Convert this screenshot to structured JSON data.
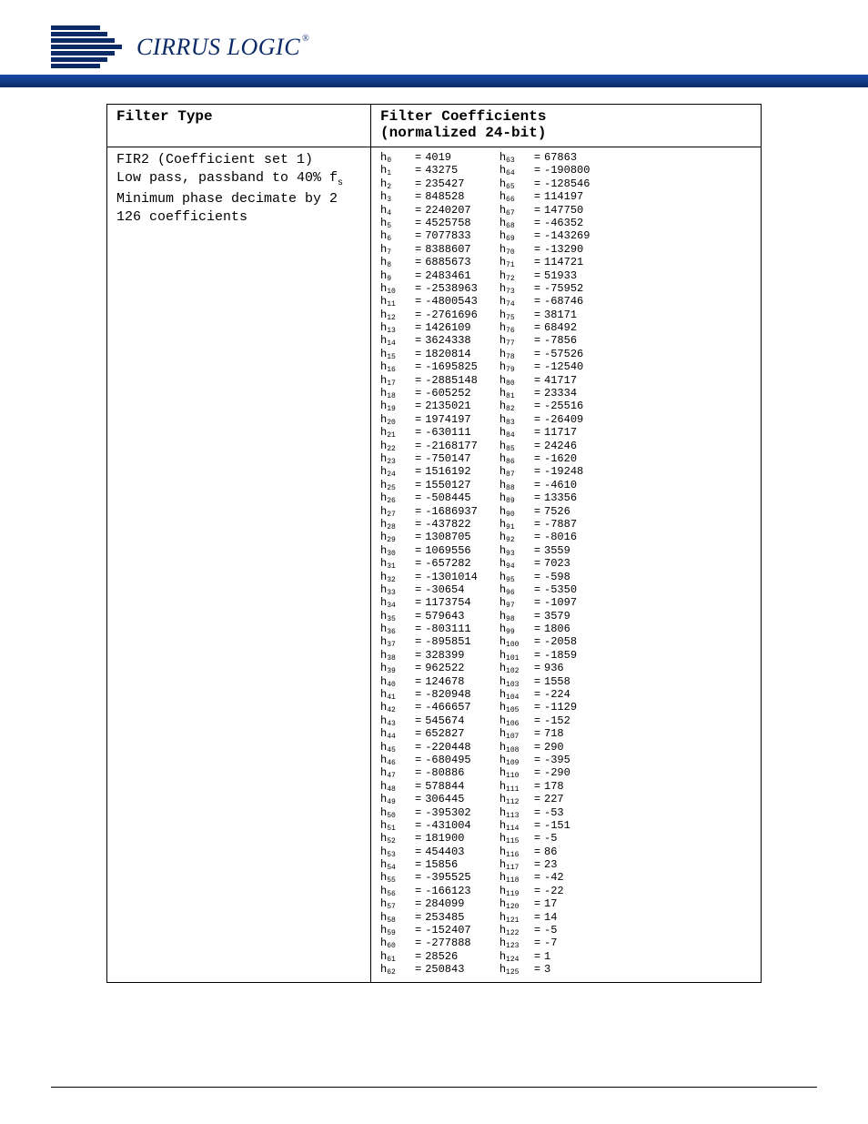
{
  "brand": {
    "name": "CIRRUS LOGIC",
    "registered": "®"
  },
  "table": {
    "headers": {
      "filter_type": "Filter Type",
      "coeff_title": "Filter Coefficients",
      "coeff_sub": "(normalized 24-bit)"
    },
    "filter_type_lines": {
      "l0": "FIR2 (Coefficient set 1)",
      "l1_pre": "Low pass, passband to 40% f",
      "l1_sub": "s",
      "l2": "Minimum phase decimate by 2",
      "l3": "126 coefficients"
    },
    "coefficients": {
      "col1": [
        {
          "i": 0,
          "v": "4019"
        },
        {
          "i": 1,
          "v": "43275"
        },
        {
          "i": 2,
          "v": "235427"
        },
        {
          "i": 3,
          "v": "848528"
        },
        {
          "i": 4,
          "v": "2240207"
        },
        {
          "i": 5,
          "v": "4525758"
        },
        {
          "i": 6,
          "v": "7077833"
        },
        {
          "i": 7,
          "v": "8388607"
        },
        {
          "i": 8,
          "v": "6885673"
        },
        {
          "i": 9,
          "v": "2483461"
        },
        {
          "i": 10,
          "v": "-2538963"
        },
        {
          "i": 11,
          "v": "-4800543"
        },
        {
          "i": 12,
          "v": "-2761696"
        },
        {
          "i": 13,
          "v": "1426109"
        },
        {
          "i": 14,
          "v": "3624338"
        },
        {
          "i": 15,
          "v": "1820814"
        },
        {
          "i": 16,
          "v": "-1695825"
        },
        {
          "i": 17,
          "v": "-2885148"
        },
        {
          "i": 18,
          "v": "-605252"
        },
        {
          "i": 19,
          "v": "2135021"
        },
        {
          "i": 20,
          "v": "1974197"
        },
        {
          "i": 21,
          "v": "-630111"
        },
        {
          "i": 22,
          "v": "-2168177"
        },
        {
          "i": 23,
          "v": "-750147"
        },
        {
          "i": 24,
          "v": "1516192"
        },
        {
          "i": 25,
          "v": "1550127"
        },
        {
          "i": 26,
          "v": "-508445"
        },
        {
          "i": 27,
          "v": "-1686937"
        },
        {
          "i": 28,
          "v": "-437822"
        },
        {
          "i": 29,
          "v": "1308705"
        },
        {
          "i": 30,
          "v": "1069556"
        },
        {
          "i": 31,
          "v": "-657282"
        },
        {
          "i": 32,
          "v": "-1301014"
        },
        {
          "i": 33,
          "v": "-30654"
        },
        {
          "i": 34,
          "v": "1173754"
        },
        {
          "i": 35,
          "v": "579643"
        },
        {
          "i": 36,
          "v": "-803111"
        },
        {
          "i": 37,
          "v": "-895851"
        },
        {
          "i": 38,
          "v": "328399"
        },
        {
          "i": 39,
          "v": "962522"
        },
        {
          "i": 40,
          "v": "124678"
        },
        {
          "i": 41,
          "v": "-820948"
        },
        {
          "i": 42,
          "v": "-466657"
        },
        {
          "i": 43,
          "v": "545674"
        },
        {
          "i": 44,
          "v": "652827"
        },
        {
          "i": 45,
          "v": "-220448"
        },
        {
          "i": 46,
          "v": "-680495"
        },
        {
          "i": 47,
          "v": "-80886"
        },
        {
          "i": 48,
          "v": "578844"
        },
        {
          "i": 49,
          "v": "306445"
        },
        {
          "i": 50,
          "v": "-395302"
        },
        {
          "i": 51,
          "v": "-431004"
        },
        {
          "i": 52,
          "v": "181900"
        },
        {
          "i": 53,
          "v": "454403"
        },
        {
          "i": 54,
          "v": "15856"
        },
        {
          "i": 55,
          "v": "-395525"
        },
        {
          "i": 56,
          "v": "-166123"
        },
        {
          "i": 57,
          "v": "284099"
        },
        {
          "i": 58,
          "v": "253485"
        },
        {
          "i": 59,
          "v": "-152407"
        },
        {
          "i": 60,
          "v": "-277888"
        },
        {
          "i": 61,
          "v": "28526"
        },
        {
          "i": 62,
          "v": "250843"
        }
      ],
      "col2": [
        {
          "i": 63,
          "v": "67863"
        },
        {
          "i": 64,
          "v": "-190800"
        },
        {
          "i": 65,
          "v": "-128546"
        },
        {
          "i": 66,
          "v": "114197"
        },
        {
          "i": 67,
          "v": "147750"
        },
        {
          "i": 68,
          "v": "-46352"
        },
        {
          "i": 69,
          "v": "-143269"
        },
        {
          "i": 70,
          "v": "-13290"
        },
        {
          "i": 71,
          "v": "114721"
        },
        {
          "i": 72,
          "v": "51933"
        },
        {
          "i": 73,
          "v": "-75952"
        },
        {
          "i": 74,
          "v": "-68746"
        },
        {
          "i": 75,
          "v": "38171"
        },
        {
          "i": 76,
          "v": "68492"
        },
        {
          "i": 77,
          "v": "-7856"
        },
        {
          "i": 78,
          "v": "-57526"
        },
        {
          "i": 79,
          "v": "-12540"
        },
        {
          "i": 80,
          "v": "41717"
        },
        {
          "i": 81,
          "v": "23334"
        },
        {
          "i": 82,
          "v": "-25516"
        },
        {
          "i": 83,
          "v": "-26409"
        },
        {
          "i": 84,
          "v": "11717"
        },
        {
          "i": 85,
          "v": "24246"
        },
        {
          "i": 86,
          "v": "-1620"
        },
        {
          "i": 87,
          "v": "-19248"
        },
        {
          "i": 88,
          "v": "-4610"
        },
        {
          "i": 89,
          "v": "13356"
        },
        {
          "i": 90,
          "v": "7526"
        },
        {
          "i": 91,
          "v": "-7887"
        },
        {
          "i": 92,
          "v": "-8016"
        },
        {
          "i": 93,
          "v": "3559"
        },
        {
          "i": 94,
          "v": "7023"
        },
        {
          "i": 95,
          "v": "-598"
        },
        {
          "i": 96,
          "v": "-5350"
        },
        {
          "i": 97,
          "v": "-1097"
        },
        {
          "i": 98,
          "v": "3579"
        },
        {
          "i": 99,
          "v": "1806"
        },
        {
          "i": 100,
          "v": "-2058"
        },
        {
          "i": 101,
          "v": "-1859"
        },
        {
          "i": 102,
          "v": "936"
        },
        {
          "i": 103,
          "v": "1558"
        },
        {
          "i": 104,
          "v": "-224"
        },
        {
          "i": 105,
          "v": "-1129"
        },
        {
          "i": 106,
          "v": "-152"
        },
        {
          "i": 107,
          "v": "718"
        },
        {
          "i": 108,
          "v": "290"
        },
        {
          "i": 109,
          "v": "-395"
        },
        {
          "i": 110,
          "v": "-290"
        },
        {
          "i": 111,
          "v": "178"
        },
        {
          "i": 112,
          "v": "227"
        },
        {
          "i": 113,
          "v": "-53"
        },
        {
          "i": 114,
          "v": "-151"
        },
        {
          "i": 115,
          "v": "-5"
        },
        {
          "i": 116,
          "v": "86"
        },
        {
          "i": 117,
          "v": "23"
        },
        {
          "i": 118,
          "v": "-42"
        },
        {
          "i": 119,
          "v": "-22"
        },
        {
          "i": 120,
          "v": "17"
        },
        {
          "i": 121,
          "v": "14"
        },
        {
          "i": 122,
          "v": "-5"
        },
        {
          "i": 123,
          "v": "-7"
        },
        {
          "i": 124,
          "v": "1"
        },
        {
          "i": 125,
          "v": "3"
        }
      ]
    }
  }
}
